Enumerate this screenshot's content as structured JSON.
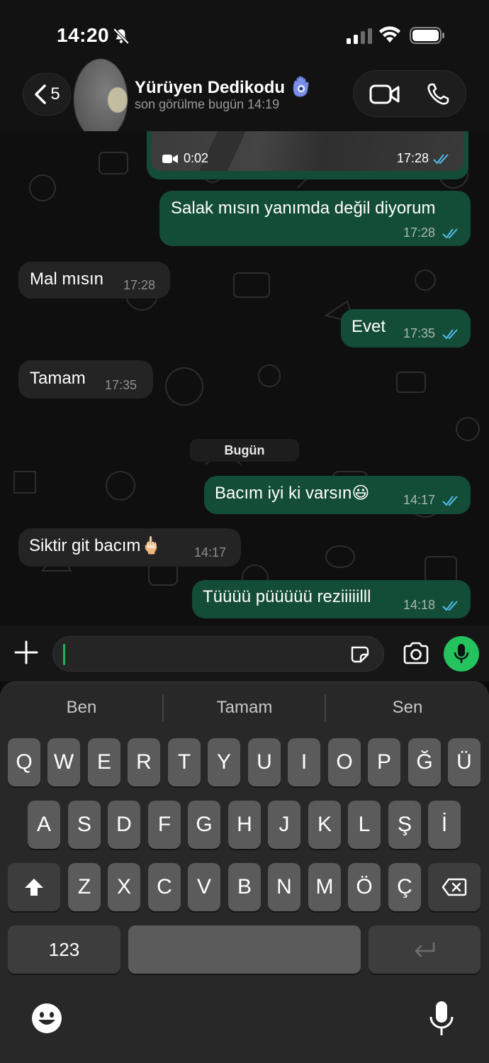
{
  "status_bar": {
    "time": "14:20"
  },
  "header": {
    "back_count": "5",
    "contact_name": "Yürüyen Dedikodu",
    "last_seen": "son görülme bugün 14:19"
  },
  "messages": {
    "media": {
      "duration": "0:02",
      "time": "17:28",
      "status": "read"
    },
    "m1": {
      "text": "Salak mısın yanımda değil diyorum",
      "time": "17:28",
      "direction": "out"
    },
    "m2": {
      "text": "Mal mısın",
      "time": "17:28",
      "direction": "in"
    },
    "m3": {
      "text": "Evet",
      "time": "17:35",
      "direction": "out"
    },
    "m4": {
      "text": "Tamam",
      "time": "17:35",
      "direction": "in"
    },
    "date_separator": "Bugün",
    "m5": {
      "text": "Bacım iyi ki varsın😃",
      "time": "14:17",
      "direction": "out"
    },
    "m6": {
      "text": "Siktir git bacım🖕🏻",
      "time": "14:17",
      "direction": "in"
    },
    "m7": {
      "text": "Tüüüü püüüüü reziiiiilll",
      "time": "14:18",
      "direction": "out"
    }
  },
  "composer": {
    "input_value": ""
  },
  "keyboard": {
    "suggestions": [
      "Ben",
      "Tamam",
      "Sen"
    ],
    "row1": [
      "Q",
      "W",
      "E",
      "R",
      "T",
      "Y",
      "U",
      "I",
      "O",
      "P",
      "Ğ",
      "Ü"
    ],
    "row2": [
      "A",
      "S",
      "D",
      "F",
      "G",
      "H",
      "J",
      "K",
      "L",
      "Ş",
      "İ"
    ],
    "row3": [
      "Z",
      "X",
      "C",
      "V",
      "B",
      "N",
      "M",
      "Ö",
      "Ç"
    ],
    "numbers_label": "123"
  },
  "colors": {
    "outgoing_bubble": "#144d37",
    "incoming_bubble": "#242424",
    "read_ticks": "#53bdeb",
    "mic_button": "#24c35e"
  }
}
